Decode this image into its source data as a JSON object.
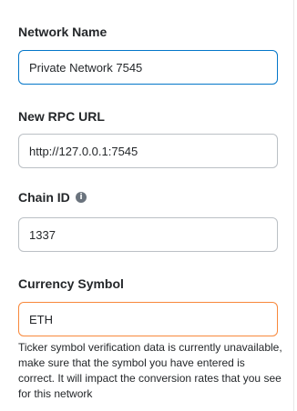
{
  "network_name": {
    "label": "Network Name",
    "value": "Private Network 7545"
  },
  "rpc_url": {
    "label": "New RPC URL",
    "value": "http://127.0.0.1:7545"
  },
  "chain_id": {
    "label": "Chain ID",
    "info_icon": "i",
    "value": "1337"
  },
  "currency_symbol": {
    "label": "Currency Symbol",
    "value": "ETH",
    "helper": "Ticker symbol verification data is currently unavailable, make sure that the symbol you have entered is correct. It will impact the conversion rates that you see for this network"
  },
  "colors": {
    "focus_border": "#0376c9",
    "warning_border": "#f8883b",
    "default_border": "#bbc0c5"
  }
}
